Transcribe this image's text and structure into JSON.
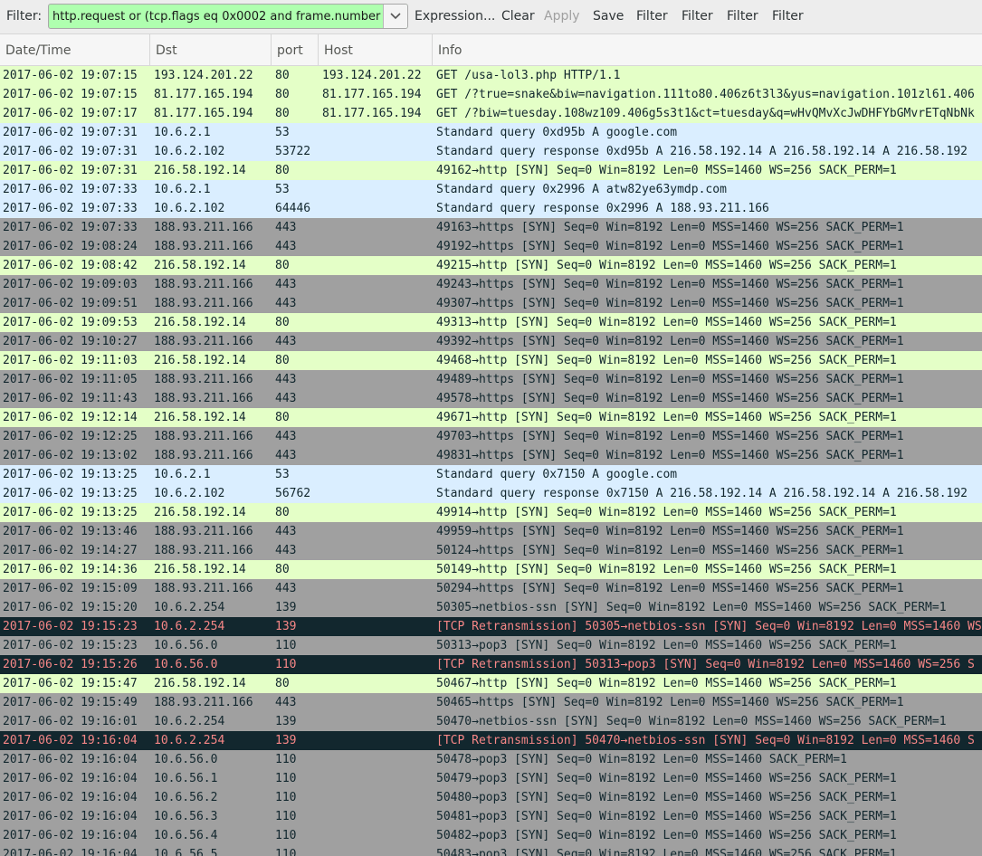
{
  "toolbar": {
    "filter_label": "Filter:",
    "filter_value": "http.request or (tcp.flags eq 0x0002 and frame.number",
    "dropdown_icon": "chevron-down-icon",
    "buttons": [
      "Expression...",
      "Clear",
      "Apply",
      "Save",
      "Filter",
      "Filter",
      "Filter",
      "Filter"
    ]
  },
  "columns": [
    "Date/Time",
    "Dst",
    "port",
    "Host",
    "Info"
  ],
  "colors": {
    "http": "#e4ffc7",
    "dns": "#daeeff",
    "syn": "#a0a0a0",
    "bad_bg": "#12272e",
    "bad_fg": "#f78787",
    "filter_ok": "#afffaf"
  },
  "rows": [
    {
      "t": "http",
      "dt": "2017-06-02 19:07:15",
      "dst": "193.124.201.22",
      "port": "80",
      "host": "193.124.201.22",
      "info": "GET /usa-lol3.php HTTP/1.1"
    },
    {
      "t": "http",
      "dt": "2017-06-02 19:07:15",
      "dst": "81.177.165.194",
      "port": "80",
      "host": "81.177.165.194",
      "info": "GET /?true=snake&biw=navigation.111to80.406z6t3l3&yus=navigation.101zl61.406"
    },
    {
      "t": "http",
      "dt": "2017-06-02 19:07:17",
      "dst": "81.177.165.194",
      "port": "80",
      "host": "81.177.165.194",
      "info": "GET /?biw=tuesday.108wz109.406g5s3t1&ct=tuesday&q=wHvQMvXcJwDHFYbGMvrETqNbNk"
    },
    {
      "t": "dns",
      "dt": "2017-06-02 19:07:31",
      "dst": "10.6.2.1",
      "port": "53",
      "host": "",
      "info": "Standard query 0xd95b  A google.com"
    },
    {
      "t": "dns",
      "dt": "2017-06-02 19:07:31",
      "dst": "10.6.2.102",
      "port": "53722",
      "host": "",
      "info": "Standard query response 0xd95b  A 216.58.192.14 A 216.58.192.14 A 216.58.192"
    },
    {
      "t": "http",
      "dt": "2017-06-02 19:07:31",
      "dst": "216.58.192.14",
      "port": "80",
      "host": "",
      "info": "49162→http [SYN] Seq=0 Win=8192 Len=0 MSS=1460 WS=256 SACK_PERM=1"
    },
    {
      "t": "dns",
      "dt": "2017-06-02 19:07:33",
      "dst": "10.6.2.1",
      "port": "53",
      "host": "",
      "info": "Standard query 0x2996  A atw82ye63ymdp.com"
    },
    {
      "t": "dns",
      "dt": "2017-06-02 19:07:33",
      "dst": "10.6.2.102",
      "port": "64446",
      "host": "",
      "info": "Standard query response 0x2996  A 188.93.211.166"
    },
    {
      "t": "syn",
      "dt": "2017-06-02 19:07:33",
      "dst": "188.93.211.166",
      "port": "443",
      "host": "",
      "info": "49163→https [SYN] Seq=0 Win=8192 Len=0 MSS=1460 WS=256 SACK_PERM=1"
    },
    {
      "t": "syn",
      "dt": "2017-06-02 19:08:24",
      "dst": "188.93.211.166",
      "port": "443",
      "host": "",
      "info": "49192→https [SYN] Seq=0 Win=8192 Len=0 MSS=1460 WS=256 SACK_PERM=1"
    },
    {
      "t": "http",
      "dt": "2017-06-02 19:08:42",
      "dst": "216.58.192.14",
      "port": "80",
      "host": "",
      "info": "49215→http [SYN] Seq=0 Win=8192 Len=0 MSS=1460 WS=256 SACK_PERM=1"
    },
    {
      "t": "syn",
      "dt": "2017-06-02 19:09:03",
      "dst": "188.93.211.166",
      "port": "443",
      "host": "",
      "info": "49243→https [SYN] Seq=0 Win=8192 Len=0 MSS=1460 WS=256 SACK_PERM=1"
    },
    {
      "t": "syn",
      "dt": "2017-06-02 19:09:51",
      "dst": "188.93.211.166",
      "port": "443",
      "host": "",
      "info": "49307→https [SYN] Seq=0 Win=8192 Len=0 MSS=1460 WS=256 SACK_PERM=1"
    },
    {
      "t": "http",
      "dt": "2017-06-02 19:09:53",
      "dst": "216.58.192.14",
      "port": "80",
      "host": "",
      "info": "49313→http [SYN] Seq=0 Win=8192 Len=0 MSS=1460 WS=256 SACK_PERM=1"
    },
    {
      "t": "syn",
      "dt": "2017-06-02 19:10:27",
      "dst": "188.93.211.166",
      "port": "443",
      "host": "",
      "info": "49392→https [SYN] Seq=0 Win=8192 Len=0 MSS=1460 WS=256 SACK_PERM=1"
    },
    {
      "t": "http",
      "dt": "2017-06-02 19:11:03",
      "dst": "216.58.192.14",
      "port": "80",
      "host": "",
      "info": "49468→http [SYN] Seq=0 Win=8192 Len=0 MSS=1460 WS=256 SACK_PERM=1"
    },
    {
      "t": "syn",
      "dt": "2017-06-02 19:11:05",
      "dst": "188.93.211.166",
      "port": "443",
      "host": "",
      "info": "49489→https [SYN] Seq=0 Win=8192 Len=0 MSS=1460 WS=256 SACK_PERM=1"
    },
    {
      "t": "syn",
      "dt": "2017-06-02 19:11:43",
      "dst": "188.93.211.166",
      "port": "443",
      "host": "",
      "info": "49578→https [SYN] Seq=0 Win=8192 Len=0 MSS=1460 WS=256 SACK_PERM=1"
    },
    {
      "t": "http",
      "dt": "2017-06-02 19:12:14",
      "dst": "216.58.192.14",
      "port": "80",
      "host": "",
      "info": "49671→http [SYN] Seq=0 Win=8192 Len=0 MSS=1460 WS=256 SACK_PERM=1"
    },
    {
      "t": "syn",
      "dt": "2017-06-02 19:12:25",
      "dst": "188.93.211.166",
      "port": "443",
      "host": "",
      "info": "49703→https [SYN] Seq=0 Win=8192 Len=0 MSS=1460 WS=256 SACK_PERM=1"
    },
    {
      "t": "syn",
      "dt": "2017-06-02 19:13:02",
      "dst": "188.93.211.166",
      "port": "443",
      "host": "",
      "info": "49831→https [SYN] Seq=0 Win=8192 Len=0 MSS=1460 WS=256 SACK_PERM=1"
    },
    {
      "t": "dns",
      "dt": "2017-06-02 19:13:25",
      "dst": "10.6.2.1",
      "port": "53",
      "host": "",
      "info": "Standard query 0x7150  A google.com"
    },
    {
      "t": "dns",
      "dt": "2017-06-02 19:13:25",
      "dst": "10.6.2.102",
      "port": "56762",
      "host": "",
      "info": "Standard query response 0x7150  A 216.58.192.14 A 216.58.192.14 A 216.58.192"
    },
    {
      "t": "http",
      "dt": "2017-06-02 19:13:25",
      "dst": "216.58.192.14",
      "port": "80",
      "host": "",
      "info": "49914→http [SYN] Seq=0 Win=8192 Len=0 MSS=1460 WS=256 SACK_PERM=1"
    },
    {
      "t": "syn",
      "dt": "2017-06-02 19:13:46",
      "dst": "188.93.211.166",
      "port": "443",
      "host": "",
      "info": "49959→https [SYN] Seq=0 Win=8192 Len=0 MSS=1460 WS=256 SACK_PERM=1"
    },
    {
      "t": "syn",
      "dt": "2017-06-02 19:14:27",
      "dst": "188.93.211.166",
      "port": "443",
      "host": "",
      "info": "50124→https [SYN] Seq=0 Win=8192 Len=0 MSS=1460 WS=256 SACK_PERM=1"
    },
    {
      "t": "http",
      "dt": "2017-06-02 19:14:36",
      "dst": "216.58.192.14",
      "port": "80",
      "host": "",
      "info": "50149→http [SYN] Seq=0 Win=8192 Len=0 MSS=1460 WS=256 SACK_PERM=1"
    },
    {
      "t": "syn",
      "dt": "2017-06-02 19:15:09",
      "dst": "188.93.211.166",
      "port": "443",
      "host": "",
      "info": "50294→https [SYN] Seq=0 Win=8192 Len=0 MSS=1460 WS=256 SACK_PERM=1"
    },
    {
      "t": "syn",
      "dt": "2017-06-02 19:15:20",
      "dst": "10.6.2.254",
      "port": "139",
      "host": "",
      "info": "50305→netbios-ssn [SYN] Seq=0 Win=8192 Len=0 MSS=1460 WS=256 SACK_PERM=1"
    },
    {
      "t": "bad",
      "dt": "2017-06-02 19:15:23",
      "dst": "10.6.2.254",
      "port": "139",
      "host": "",
      "info": "[TCP Retransmission] 50305→netbios-ssn [SYN] Seq=0 Win=8192 Len=0 MSS=1460 WS"
    },
    {
      "t": "syn",
      "dt": "2017-06-02 19:15:23",
      "dst": "10.6.56.0",
      "port": "110",
      "host": "",
      "info": "50313→pop3 [SYN] Seq=0 Win=8192 Len=0 MSS=1460 WS=256 SACK_PERM=1"
    },
    {
      "t": "bad",
      "dt": "2017-06-02 19:15:26",
      "dst": "10.6.56.0",
      "port": "110",
      "host": "",
      "info": "[TCP Retransmission] 50313→pop3 [SYN] Seq=0 Win=8192 Len=0 MSS=1460 WS=256 S"
    },
    {
      "t": "http",
      "dt": "2017-06-02 19:15:47",
      "dst": "216.58.192.14",
      "port": "80",
      "host": "",
      "info": "50467→http [SYN] Seq=0 Win=8192 Len=0 MSS=1460 WS=256 SACK_PERM=1"
    },
    {
      "t": "syn",
      "dt": "2017-06-02 19:15:49",
      "dst": "188.93.211.166",
      "port": "443",
      "host": "",
      "info": "50465→https [SYN] Seq=0 Win=8192 Len=0 MSS=1460 WS=256 SACK_PERM=1"
    },
    {
      "t": "syn",
      "dt": "2017-06-02 19:16:01",
      "dst": "10.6.2.254",
      "port": "139",
      "host": "",
      "info": "50470→netbios-ssn [SYN] Seq=0 Win=8192 Len=0 MSS=1460 WS=256 SACK_PERM=1"
    },
    {
      "t": "bad",
      "dt": "2017-06-02 19:16:04",
      "dst": "10.6.2.254",
      "port": "139",
      "host": "",
      "info": "[TCP Retransmission] 50470→netbios-ssn [SYN] Seq=0 Win=8192 Len=0 MSS=1460 S"
    },
    {
      "t": "syn",
      "dt": "2017-06-02 19:16:04",
      "dst": "10.6.56.0",
      "port": "110",
      "host": "",
      "info": "50478→pop3 [SYN] Seq=0 Win=8192 Len=0 MSS=1460 SACK_PERM=1"
    },
    {
      "t": "syn",
      "dt": "2017-06-02 19:16:04",
      "dst": "10.6.56.1",
      "port": "110",
      "host": "",
      "info": "50479→pop3 [SYN] Seq=0 Win=8192 Len=0 MSS=1460 WS=256 SACK_PERM=1"
    },
    {
      "t": "syn",
      "dt": "2017-06-02 19:16:04",
      "dst": "10.6.56.2",
      "port": "110",
      "host": "",
      "info": "50480→pop3 [SYN] Seq=0 Win=8192 Len=0 MSS=1460 WS=256 SACK_PERM=1"
    },
    {
      "t": "syn",
      "dt": "2017-06-02 19:16:04",
      "dst": "10.6.56.3",
      "port": "110",
      "host": "",
      "info": "50481→pop3 [SYN] Seq=0 Win=8192 Len=0 MSS=1460 WS=256 SACK_PERM=1"
    },
    {
      "t": "syn",
      "dt": "2017-06-02 19:16:04",
      "dst": "10.6.56.4",
      "port": "110",
      "host": "",
      "info": "50482→pop3 [SYN] Seq=0 Win=8192 Len=0 MSS=1460 WS=256 SACK_PERM=1"
    },
    {
      "t": "syn",
      "dt": "2017-06-02 19:16:04",
      "dst": "10.6.56.5",
      "port": "110",
      "host": "",
      "info": "50483→pop3 [SYN] Seq=0 Win=8192 Len=0 MSS=1460 WS=256 SACK_PERM=1"
    }
  ]
}
